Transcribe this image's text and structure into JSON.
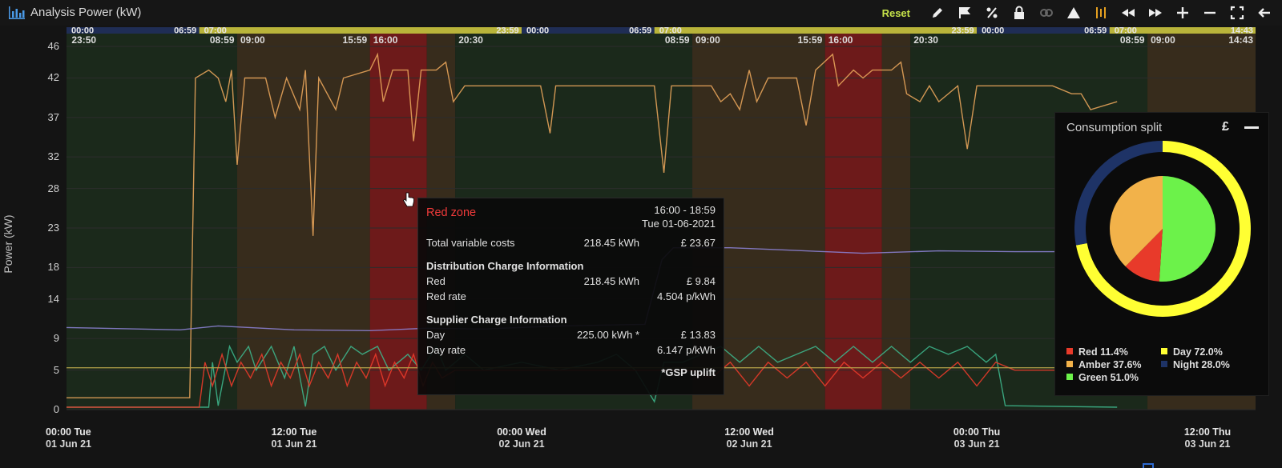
{
  "window": {
    "title": "Analysis Power (kW)"
  },
  "toolbar": {
    "reset_label": "Reset",
    "icons": [
      "pencil-icon",
      "flag-icon",
      "percent-icon",
      "lock-icon",
      "link-off-icon",
      "warning-triangle-icon",
      "bars-icon",
      "rewind-icon",
      "fast-forward-icon",
      "zoom-in-plus-icon",
      "zoom-out-minus-icon",
      "fullscreen-icon",
      "back-arrow-icon"
    ]
  },
  "colors": {
    "red_zone": "#7a1a1a",
    "amber_zone": "#3a2f1e",
    "green_zone": "#1c2b1c",
    "day": "#ffff33",
    "night": "#1e3366",
    "red": "#e83a2a",
    "amber": "#f2b24a",
    "green": "#6cf24a",
    "orange_line": "#e6a35a",
    "purple_line": "#8a7fd0",
    "teal_line": "#3db38a"
  },
  "chart_data": {
    "type": "line",
    "ylabel": "Power (kW)",
    "yticks": [
      "0",
      "5",
      "9",
      "14",
      "18",
      "23",
      "28",
      "32",
      "37",
      "42",
      "46"
    ],
    "ylim": [
      0,
      46
    ],
    "xticks": [
      {
        "line1": "00:00 Tue",
        "line2": "01 Jun 21"
      },
      {
        "line1": "12:00 Tue",
        "line2": "01 Jun 21"
      },
      {
        "line1": "00:00 Wed",
        "line2": "02 Jun 21"
      },
      {
        "line1": "12:00 Wed",
        "line2": "02 Jun 21"
      },
      {
        "line1": "00:00 Thu",
        "line2": "03 Jun 21"
      },
      {
        "line1": "12:00 Thu",
        "line2": "03 Jun 21"
      }
    ],
    "day_night_labels": [
      "00:00",
      "06:59",
      "07:00",
      "23:59",
      "00:00",
      "06:59",
      "07:00",
      "23:59",
      "00:00",
      "06:59",
      "07:00",
      "14:43"
    ],
    "zone_labels": [
      "23:50",
      "08:59",
      "09:00",
      "15:59",
      "16:00",
      "20:30",
      "08:59",
      "09:00",
      "15:59",
      "16:00",
      "20:30",
      "08:59",
      "09:00",
      "14:43"
    ],
    "zones": [
      {
        "type": "green",
        "start": 0,
        "end": 9
      },
      {
        "type": "amber",
        "start": 9,
        "end": 16
      },
      {
        "type": "red",
        "start": 16,
        "end": 19
      },
      {
        "type": "amber",
        "start": 19,
        "end": 20.5
      },
      {
        "type": "green",
        "start": 20.5,
        "end": 33
      },
      {
        "type": "amber",
        "start": 33,
        "end": 40
      },
      {
        "type": "red",
        "start": 40,
        "end": 43
      },
      {
        "type": "amber",
        "start": 43,
        "end": 44.5
      },
      {
        "type": "green",
        "start": 44.5,
        "end": 57
      },
      {
        "type": "amber",
        "start": 57,
        "end": 62.7
      }
    ],
    "x_hours_range": [
      0,
      62.7
    ],
    "series": [
      {
        "color": "#e6a35a",
        "points": [
          [
            0,
            1.5
          ],
          [
            6.5,
            1.5
          ],
          [
            6.8,
            42
          ],
          [
            7.5,
            43
          ],
          [
            8,
            42
          ],
          [
            8.4,
            39
          ],
          [
            8.7,
            43
          ],
          [
            9,
            31
          ],
          [
            9.4,
            42
          ],
          [
            10.5,
            42
          ],
          [
            11,
            37
          ],
          [
            11.6,
            42
          ],
          [
            12.3,
            38
          ],
          [
            12.6,
            43
          ],
          [
            13,
            22
          ],
          [
            13.3,
            42
          ],
          [
            14.2,
            38
          ],
          [
            14.6,
            42
          ],
          [
            16,
            43
          ],
          [
            16.4,
            45
          ],
          [
            16.7,
            39
          ],
          [
            17.2,
            43
          ],
          [
            18,
            43
          ],
          [
            18.3,
            34
          ],
          [
            18.7,
            43
          ],
          [
            19.5,
            43
          ],
          [
            20,
            44
          ],
          [
            20.4,
            39
          ],
          [
            21,
            41
          ],
          [
            25,
            41
          ],
          [
            25.5,
            35
          ],
          [
            25.8,
            41
          ],
          [
            30,
            41
          ],
          [
            31,
            41
          ],
          [
            31.5,
            30
          ],
          [
            31.9,
            41
          ],
          [
            34,
            41
          ],
          [
            34.5,
            39
          ],
          [
            35,
            40
          ],
          [
            35.5,
            38
          ],
          [
            36,
            43
          ],
          [
            36.4,
            39
          ],
          [
            37,
            42
          ],
          [
            38.5,
            42
          ],
          [
            39,
            36
          ],
          [
            39.5,
            43
          ],
          [
            40.4,
            45
          ],
          [
            40.7,
            41
          ],
          [
            41.5,
            43
          ],
          [
            42,
            42
          ],
          [
            42.5,
            43
          ],
          [
            43.5,
            43
          ],
          [
            44,
            44
          ],
          [
            44.3,
            40
          ],
          [
            45,
            39
          ],
          [
            45.5,
            41
          ],
          [
            46,
            39
          ],
          [
            47,
            41
          ],
          [
            47.5,
            33
          ],
          [
            48,
            41
          ],
          [
            52,
            41
          ],
          [
            53,
            40
          ],
          [
            53.5,
            40
          ],
          [
            54,
            38
          ],
          [
            55.4,
            39
          ]
        ]
      },
      {
        "color": "#8a7fd0",
        "points": [
          [
            0,
            10.4
          ],
          [
            6,
            10.1
          ],
          [
            8,
            10.6
          ],
          [
            12,
            10.1
          ],
          [
            16,
            10
          ],
          [
            19,
            10.3
          ],
          [
            22,
            10.2
          ],
          [
            26,
            10.6
          ],
          [
            30.5,
            10.8
          ],
          [
            31.4,
            19
          ],
          [
            32,
            20.5
          ],
          [
            35,
            20.5
          ],
          [
            38,
            20.2
          ],
          [
            40,
            20
          ],
          [
            42,
            19.8
          ],
          [
            46,
            20.1
          ],
          [
            50,
            20
          ],
          [
            55.4,
            20
          ]
        ]
      },
      {
        "color": "#3db38a",
        "points": [
          [
            0,
            0.3
          ],
          [
            7.5,
            0.3
          ],
          [
            7.7,
            6
          ],
          [
            8,
            0.5
          ],
          [
            8.6,
            8
          ],
          [
            9,
            6
          ],
          [
            9.6,
            8
          ],
          [
            10,
            5
          ],
          [
            10.8,
            8
          ],
          [
            11.5,
            4
          ],
          [
            12,
            8
          ],
          [
            12.6,
            0.4
          ],
          [
            13,
            7
          ],
          [
            13.6,
            8
          ],
          [
            14.2,
            5
          ],
          [
            15,
            8
          ],
          [
            15.6,
            7
          ],
          [
            16.4,
            8
          ],
          [
            17,
            5
          ],
          [
            18,
            7
          ],
          [
            18.7,
            5
          ],
          [
            19.5,
            8
          ],
          [
            20,
            5
          ],
          [
            21,
            7
          ],
          [
            22,
            5
          ],
          [
            24,
            6
          ],
          [
            26,
            5
          ],
          [
            28,
            6
          ],
          [
            29,
            7
          ],
          [
            30,
            5
          ],
          [
            31,
            1
          ],
          [
            31.5,
            6
          ],
          [
            32.5,
            6
          ],
          [
            33.5,
            7
          ],
          [
            34.5,
            8
          ],
          [
            35.5,
            6
          ],
          [
            36.5,
            8
          ],
          [
            37.5,
            6
          ],
          [
            38.5,
            7
          ],
          [
            39.5,
            8
          ],
          [
            40.5,
            6
          ],
          [
            41.5,
            8
          ],
          [
            42.5,
            6
          ],
          [
            43.5,
            8
          ],
          [
            44.5,
            6
          ],
          [
            45.5,
            8
          ],
          [
            46.5,
            7
          ],
          [
            47.5,
            8
          ],
          [
            48.5,
            6
          ],
          [
            49,
            7
          ],
          [
            49.5,
            0.5
          ],
          [
            55.4,
            0.3
          ]
        ]
      },
      {
        "color": "#e83a2a",
        "points": [
          [
            0,
            0.3
          ],
          [
            7,
            0.3
          ],
          [
            7.3,
            6
          ],
          [
            7.7,
            3
          ],
          [
            8.2,
            7
          ],
          [
            8.7,
            3
          ],
          [
            9.2,
            6
          ],
          [
            9.7,
            4
          ],
          [
            10.3,
            7
          ],
          [
            10.8,
            3
          ],
          [
            11.3,
            6
          ],
          [
            11.8,
            4
          ],
          [
            12.3,
            7
          ],
          [
            12.8,
            3
          ],
          [
            13.3,
            6
          ],
          [
            13.8,
            4
          ],
          [
            14.3,
            7
          ],
          [
            14.8,
            3
          ],
          [
            15.3,
            6
          ],
          [
            15.8,
            4
          ],
          [
            16.3,
            7
          ],
          [
            16.8,
            3
          ],
          [
            17.3,
            6
          ],
          [
            17.8,
            4
          ],
          [
            18.3,
            7
          ],
          [
            18.8,
            3
          ],
          [
            19.3,
            6
          ],
          [
            19.8,
            4
          ],
          [
            20.5,
            5
          ],
          [
            25,
            5
          ],
          [
            30,
            5
          ],
          [
            33,
            5
          ],
          [
            34,
            4
          ],
          [
            35,
            6
          ],
          [
            36,
            3
          ],
          [
            37,
            6
          ],
          [
            38,
            4
          ],
          [
            39,
            6
          ],
          [
            40,
            3
          ],
          [
            41,
            6
          ],
          [
            42,
            4
          ],
          [
            43,
            6
          ],
          [
            44,
            4
          ],
          [
            45,
            6
          ],
          [
            46,
            4
          ],
          [
            47,
            6
          ],
          [
            48,
            3
          ],
          [
            49,
            6
          ],
          [
            50,
            5
          ],
          [
            55.4,
            5
          ]
        ]
      },
      {
        "color": "#b5a24a",
        "points": [
          [
            0,
            5.3
          ],
          [
            62.7,
            5.3
          ]
        ]
      }
    ]
  },
  "tooltip": {
    "zone": "Red zone",
    "time": "16:00 - 18:59",
    "date": "Tue 01-06-2021",
    "total_label": "Total variable costs",
    "total_kwh": "218.45 kWh",
    "total_cost": "£ 23.67",
    "dist_heading": "Distribution Charge Information",
    "red_label": "Red",
    "red_kwh": "218.45 kWh",
    "red_cost": "£ 9.84",
    "red_rate_label": "Red rate",
    "red_rate": "4.504 p/kWh",
    "supplier_heading": "Supplier Charge Information",
    "day_label": "Day",
    "day_kwh": "225.00 kWh *",
    "day_cost": "£ 13.83",
    "day_rate_label": "Day rate",
    "day_rate": "6.147 p/kWh",
    "footnote": "*GSP uplift"
  },
  "consumption": {
    "title": "Consumption split",
    "currency_toggle": "£",
    "inner": [
      {
        "name": "Red",
        "pct": 11.4
      },
      {
        "name": "Amber",
        "pct": 37.6
      },
      {
        "name": "Green",
        "pct": 51.0
      }
    ],
    "outer": [
      {
        "name": "Day",
        "pct": 72.0
      },
      {
        "name": "Night",
        "pct": 28.0
      }
    ],
    "legend": {
      "red": "Red 11.4%",
      "amber": "Amber 37.6%",
      "green": "Green 51.0%",
      "day": "Day 72.0%",
      "night": "Night 28.0%"
    }
  }
}
